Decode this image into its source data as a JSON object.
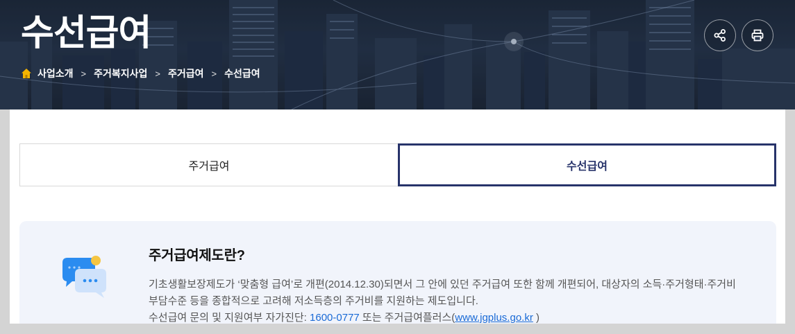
{
  "page": {
    "title": "수선급여"
  },
  "breadcrumb": {
    "items": [
      "사업소개",
      "주거복지사업",
      "주거급여",
      "수선급여"
    ],
    "separator": ">"
  },
  "header_actions": {
    "share_icon": "share-icon",
    "print_icon": "print-icon"
  },
  "tabs": [
    {
      "label": "주거급여",
      "active": false
    },
    {
      "label": "수선급여",
      "active": true
    }
  ],
  "info": {
    "icon": "chat-bubbles-icon",
    "heading": "주거급여제도란?",
    "line1": "기초생활보장제도가 ‘맞춤형 급여’로 개편(2014.12.30)되면서 그 안에 있던 주거급여 또한 함께 개편되어, 대상자의 소득·주거형태·주거비",
    "line2": "부담수준 등을 종합적으로 고려해 저소득층의 주거비를 지원하는 제도입니다.",
    "line3_prefix": "수선급여 문의 및 지원여부 자가진단: ",
    "phone": "1600-0777",
    "line3_middle": " 또는 주거급여플러스(",
    "site": "www.jgplus.go.kr",
    "line3_suffix": " )"
  },
  "colors": {
    "active_tab_border": "#27336a",
    "link": "#1a6ad6",
    "info_bg": "#f1f4fb",
    "home_icon": "#f5b400"
  }
}
